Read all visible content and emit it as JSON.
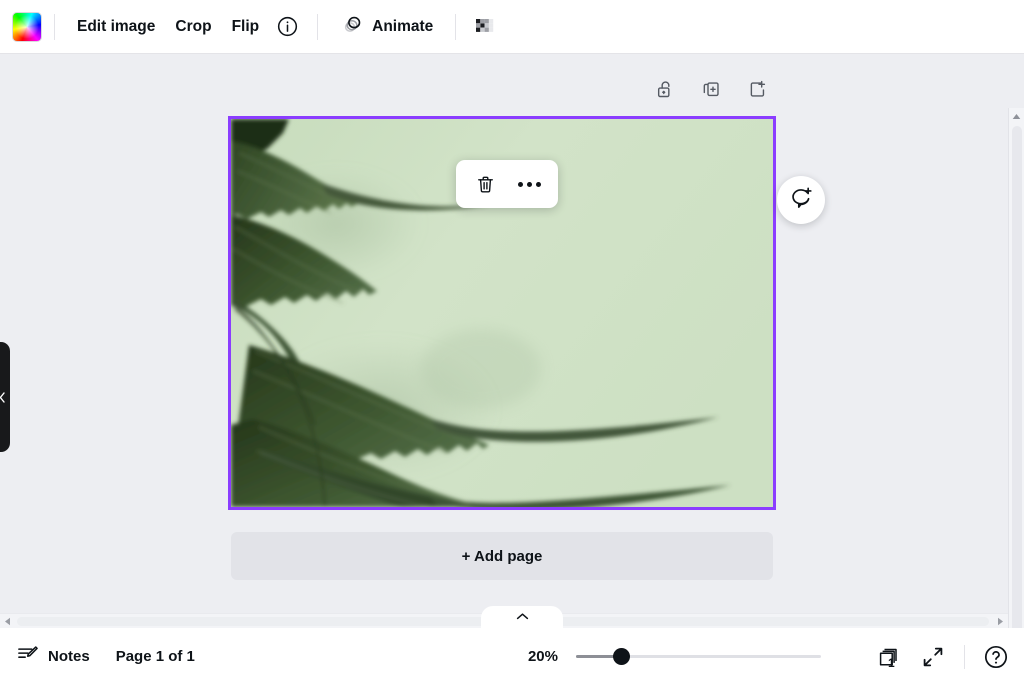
{
  "app": {
    "accent_purple": "#8b3dff",
    "canvas_bg": "#edeef2"
  },
  "toolbar": {
    "swatch_name": "color-gradient-swatch",
    "items": [
      {
        "label": "Edit image",
        "name": "edit-image-button"
      },
      {
        "label": "Crop",
        "name": "crop-button"
      },
      {
        "label": "Flip",
        "name": "flip-button"
      }
    ],
    "info_icon": "info-circle-icon",
    "animate": {
      "label": "Animate",
      "icon": "animate-icon"
    },
    "transparency_icon": "transparency-checkerboard-icon"
  },
  "page_tools": {
    "lock": "unlock-icon",
    "duplicate": "duplicate-page-icon",
    "add": "add-page-icon"
  },
  "element_toolbar": {
    "delete": "trash-icon",
    "more": "more-options-icon"
  },
  "comment": {
    "icon": "add-comment-icon"
  },
  "canvas": {
    "alt": "Dark green serrated palm leaves on a light sage green background",
    "bg_light": "#d7e6ce",
    "bg_mid": "#cde0c3",
    "bg_deep": "#c3d9b8",
    "leaf_dark": "#3f5a2f",
    "leaf_mid": "#4e6b37",
    "leaf_deep": "#2c3f20"
  },
  "add_page": {
    "label": "+ Add page"
  },
  "collapse": {
    "icon": "chevron-left-icon"
  },
  "panel_tab": {
    "icon": "chevron-up-icon"
  },
  "bottom": {
    "notes": {
      "label": "Notes",
      "icon": "notes-pencil-icon"
    },
    "page_indicator": "Page 1 of 1",
    "zoom": {
      "value": "20%",
      "percent": 20
    },
    "pages_icon": {
      "name": "page-stack-icon",
      "count": "1"
    },
    "fullscreen_icon": "expand-fullscreen-icon",
    "help_icon": "help-circle-icon"
  },
  "scrollbars": {
    "vertical": "vertical-scrollbar",
    "horizontal": "horizontal-scrollbar"
  }
}
